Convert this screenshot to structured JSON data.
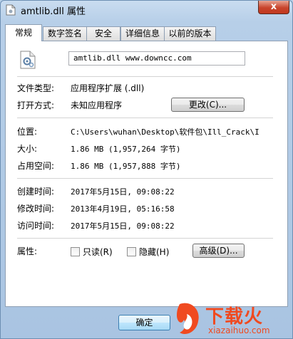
{
  "window": {
    "title": "amtlib.dll 属性",
    "close_label": "x"
  },
  "tabs": [
    {
      "label": "常规",
      "active": true
    },
    {
      "label": "数字签名",
      "active": false
    },
    {
      "label": "安全",
      "active": false
    },
    {
      "label": "详细信息",
      "active": false
    },
    {
      "label": "以前的版本",
      "active": false
    }
  ],
  "general": {
    "file_name": "amtlib.dll  www.downcc.com",
    "file_type_label": "文件类型:",
    "file_type_value": "应用程序扩展 (.dll)",
    "open_with_label": "打开方式:",
    "open_with_value": "未知应用程序",
    "change_button": "更改(C)...",
    "location_label": "位置:",
    "location_value": "C:\\Users\\wuhan\\Desktop\\软件包\\Ill_Crack\\I",
    "size_label": "大小:",
    "size_value": "1.86 MB (1,957,264 字节)",
    "size_on_disk_label": "占用空间:",
    "size_on_disk_value": "1.86 MB (1,957,888 字节)",
    "created_label": "创建时间:",
    "created_value": "2017年5月15日, 09:08:22",
    "modified_label": "修改时间:",
    "modified_value": "2013年4月19日, 05:16:58",
    "accessed_label": "访问时间:",
    "accessed_value": "2017年5月15日, 09:08:22",
    "attributes_label": "属性:",
    "readonly_label": "只读(R)",
    "hidden_label": "隐藏(H)",
    "advanced_button": "高级(D)..."
  },
  "footer": {
    "ok_button": "确定"
  },
  "watermark": {
    "brand": "下载火",
    "domain": "xiazaihuo.com"
  }
}
